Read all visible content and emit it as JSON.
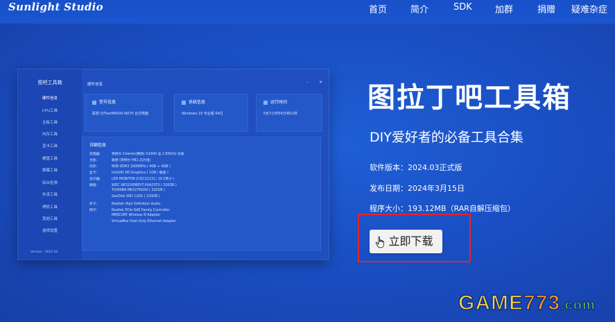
{
  "site": {
    "brand": "Sunlight Studio",
    "nav": [
      "首页",
      "简介",
      "SDK",
      "加群",
      "捐赠",
      "疑难杂症"
    ]
  },
  "preview": {
    "app_title": "图吧工具箱",
    "window_title": "硬件信息",
    "window_controls": [
      "-",
      "×"
    ],
    "sidebar": [
      "硬件信息",
      "CPU工具",
      "主板工具",
      "内存工具",
      "显卡工具",
      "硬盘工具",
      "屏幕工具",
      "综合检测",
      "外设工具",
      "烤机工具",
      "其他工具",
      "选项设置"
    ],
    "version": "Version : 2021.04",
    "cards": [
      {
        "title": "型号信息",
        "value": "联想 QiTianM4500-N070 台式电脑"
      },
      {
        "title": "系统信息",
        "value": "Windows 10 专业版 64位"
      },
      {
        "title": "运行时间",
        "value": "0天7小时54分钟22秒"
      }
    ],
    "detail": {
      "title": "详细信息",
      "rows": [
        {
          "k": "处理器:",
          "v": "英特尔 Celeron(赛扬) G1840 @ 2.80GHz 双核"
        },
        {
          "k": "主板:",
          "v": "联想 (英特尔 H81 芯片组)"
        },
        {
          "k": "内存:",
          "v": "8GB DDR3 1600MHz ( 4GB + 4GB )"
        },
        {
          "k": "显卡:",
          "v": "Intel(R) HD Graphics ( 1GB / 联想 )"
        },
        {
          "k": "显示器:",
          "v": "LED MONITOR [CGC2213] ( 19.5英寸 )"
        },
        {
          "k": "硬盘:",
          "v": "WDC WD3200BEVT-00A23T0 ( 320GB )"
        },
        {
          "k": "",
          "v": "TOSHIBA MK3276GSX ( 320GB )"
        },
        {
          "k": "",
          "v": "SanDisk SSD 120G ( 120GB )"
        },
        {
          "k": "声卡:",
          "v": "Realtek High Definition Audio"
        },
        {
          "k": "网卡:",
          "v": "Realtek PCIe GbE Family Controller"
        },
        {
          "k": "",
          "v": "MERCURY Wireless N Adapter"
        },
        {
          "k": "",
          "v": "VirtualBox Host-Only Ethernet Adapter"
        }
      ]
    }
  },
  "hero": {
    "title": "图拉丁吧工具箱",
    "subtitle": "DIY爱好者的必备工具合集",
    "version": "软件版本：2024.03正式版",
    "date": "发布日期：2024年3月15日",
    "size": "程序大小：193.12MB（RAR自解压缩包）",
    "download_label": "立即下载"
  },
  "watermark": {
    "game": "GAME",
    "num": "773",
    "com": ".com"
  },
  "colors": {
    "background": "#1a4fc4",
    "highlight_box": "#e0262c",
    "button": "#f2f2f2"
  }
}
